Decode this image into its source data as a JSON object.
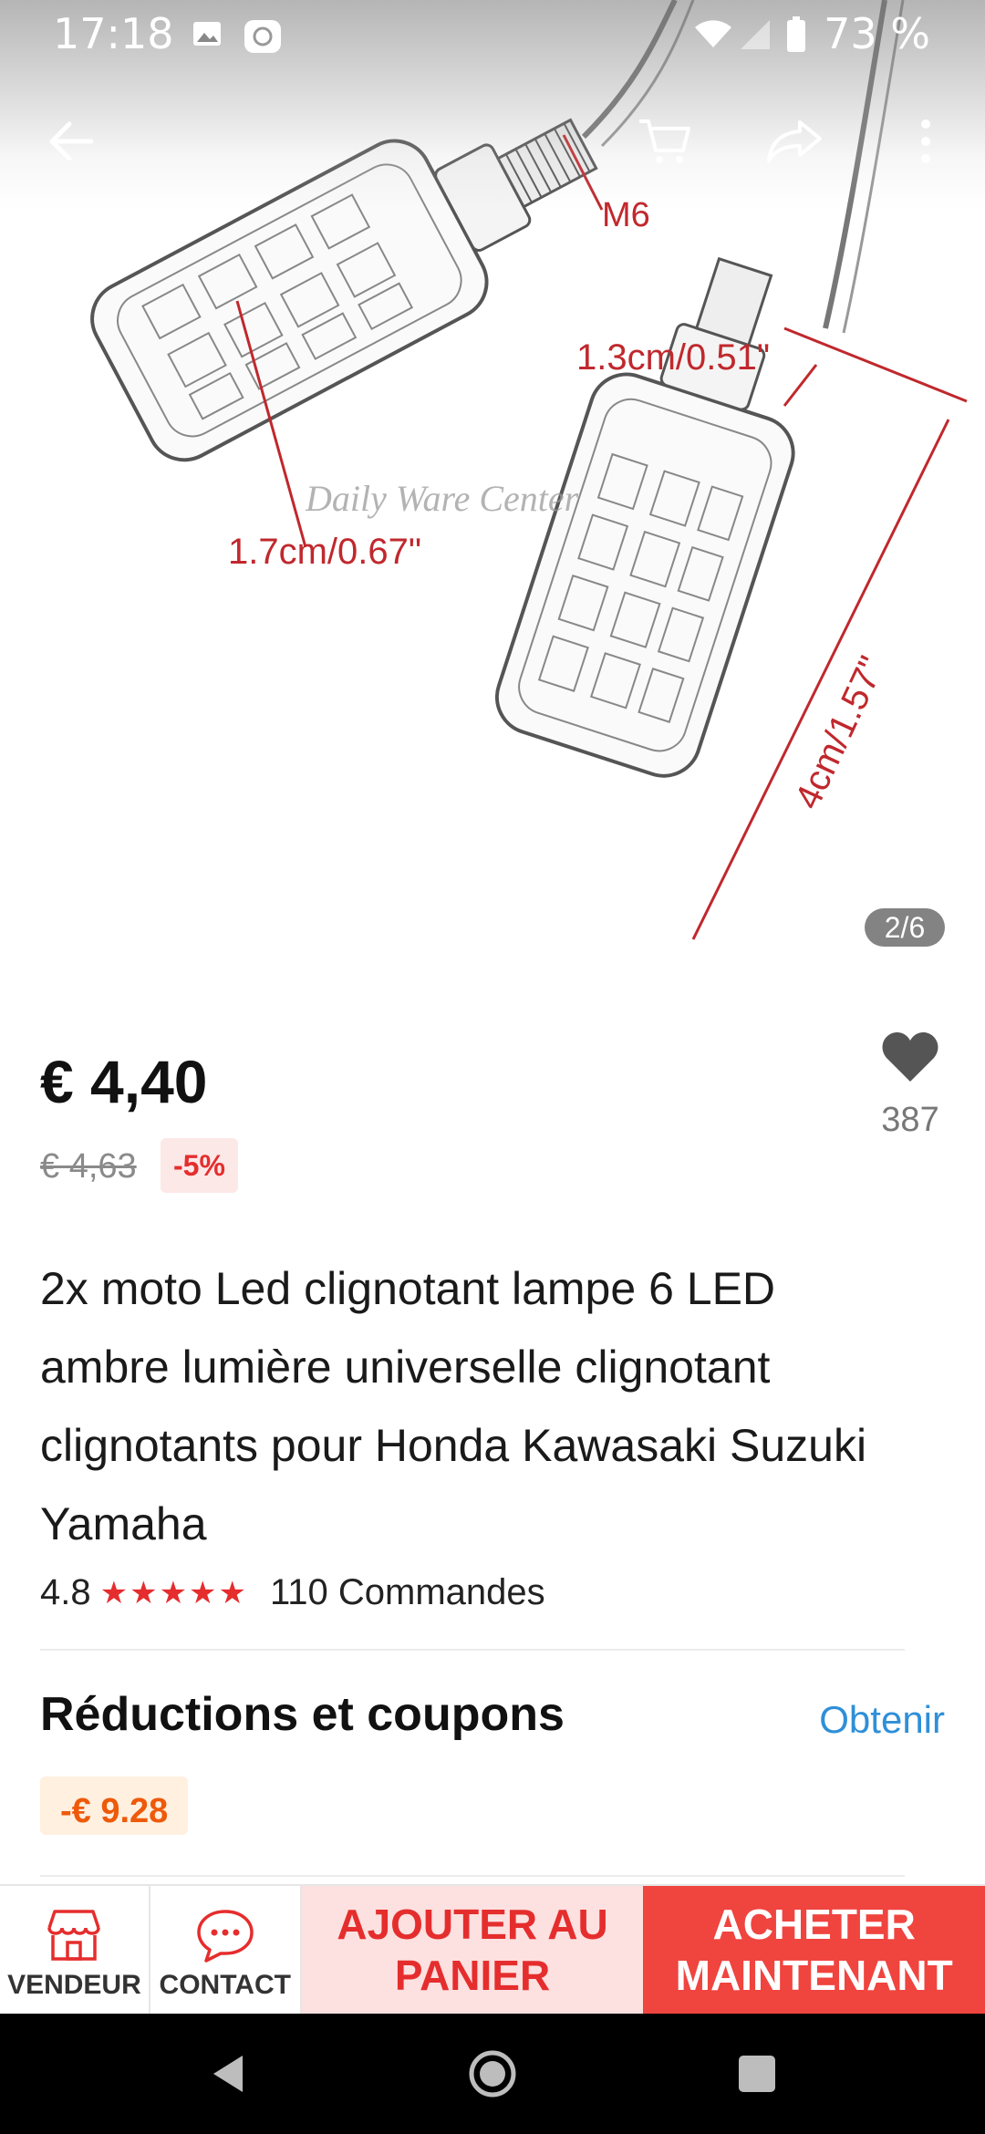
{
  "status_bar": {
    "time": "17:18",
    "battery_text": "73 %",
    "icons": [
      "image-icon",
      "mi-icon",
      "wifi-icon",
      "signal-icon",
      "battery-icon"
    ]
  },
  "topbar": {
    "icons": [
      "back-arrow-icon",
      "cart-icon",
      "share-icon",
      "more-vertical-icon"
    ]
  },
  "gallery": {
    "counter": "2/6",
    "annotations": {
      "thread": "M6",
      "thread_length": "1.3cm/0.51\"",
      "width": "1.7cm/0.67\"",
      "length": "4cm/1.57\"",
      "watermark": "Daily Ware Center"
    }
  },
  "product": {
    "price": "€ 4,40",
    "original_price": "€ 4,63",
    "discount": "-5%",
    "wishlist_count": "387",
    "title": "2x moto Led clignotant lampe 6 LED ambre lumière universelle clignotant clignotants pour Honda Kawasaki Suzuki Yamaha",
    "rating": "4.8",
    "stars": "★★★★★",
    "orders": "110 Commandes"
  },
  "coupons": {
    "title": "Réductions et coupons",
    "link": "Obtenir",
    "coupon": "-€ 9.28"
  },
  "actions": {
    "seller": "VENDEUR",
    "contact": "CONTACT",
    "add_to_cart": "AJOUTER AU PANIER",
    "buy_now": "ACHETER MAINTENANT"
  },
  "colors": {
    "accent_red": "#f0443f",
    "light_red": "#fde0e0",
    "link_blue": "#2f8fd8",
    "coupon_orange": "#ee5a0a",
    "dimension_red": "#c0282d"
  }
}
